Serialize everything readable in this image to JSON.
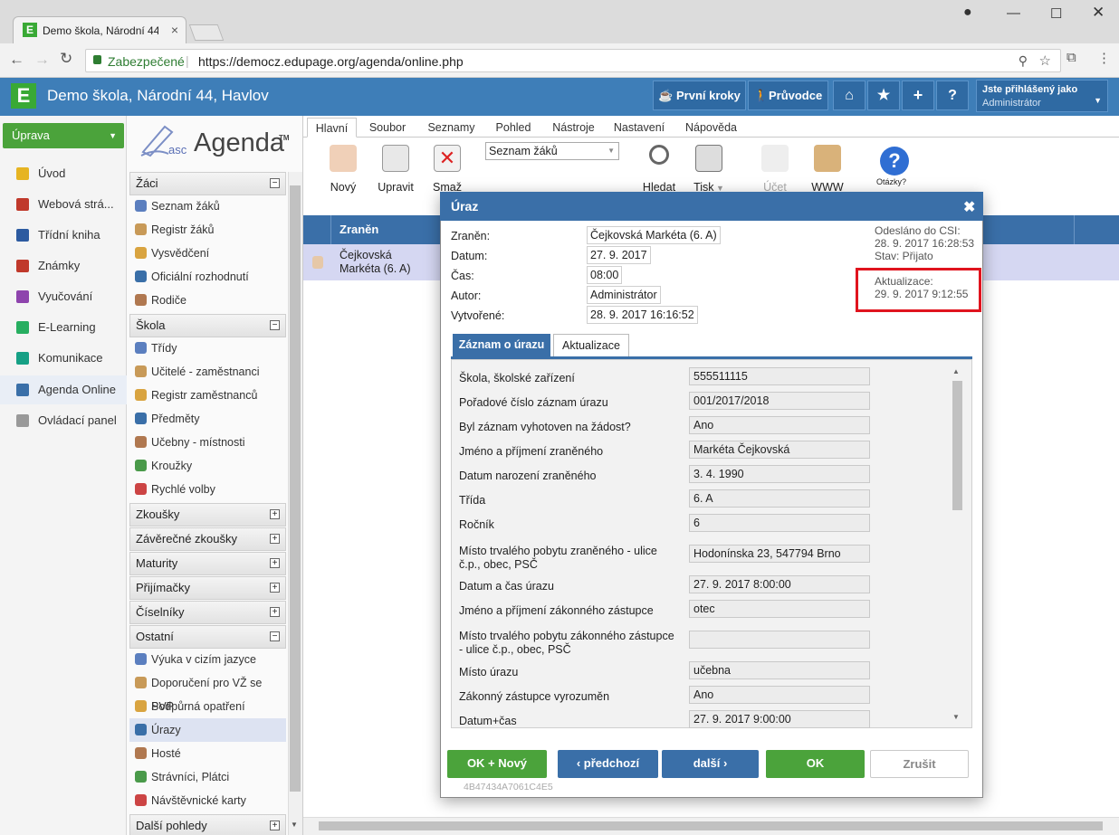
{
  "browser": {
    "tab_title": "Demo škola, Národní 44",
    "secure_label": "Zabezpečené",
    "url": "https://democz.edupage.org/agenda/online.php"
  },
  "header": {
    "school_name": "Demo škola, Národní 44, Havlov",
    "btn_first_steps": "První kroky",
    "btn_guide": "Průvodce",
    "logged_in_label": "Jste přihlášený jako",
    "logged_in_user": "Administrátor"
  },
  "leftnav": {
    "edit_button": "Úprava",
    "items": [
      {
        "label": "Úvod",
        "color": "#e6b422"
      },
      {
        "label": "Webová strá...",
        "color": "#c0392b"
      },
      {
        "label": "Třídní kniha",
        "color": "#2c5aa0"
      },
      {
        "label": "Známky",
        "color": "#c0392b"
      },
      {
        "label": "Vyučování",
        "color": "#8e44ad"
      },
      {
        "label": "E-Learning",
        "color": "#27ae60"
      },
      {
        "label": "Komunikace",
        "color": "#16a085"
      },
      {
        "label": "Agenda Online",
        "color": "#3a6fa8"
      },
      {
        "label": "Ovládací panel",
        "color": "#999999"
      }
    ]
  },
  "panel2": {
    "logo_asc": "asc",
    "logo_agenda": "Agenda",
    "logo_tm": "TM",
    "sections": {
      "zaci": "Žáci",
      "skola": "Škola",
      "zkousky": "Zkoušky",
      "zaverecne": "Závěrečné zkoušky",
      "maturity": "Maturity",
      "prijimacky": "Přijímačky",
      "ciselniky": "Číselníky",
      "ostatni": "Ostatní",
      "dalsi": "Další pohledy"
    },
    "zaci_items": [
      "Seznam žáků",
      "Registr žáků",
      "Vysvědčení",
      "Oficiální rozhodnutí",
      "Rodiče"
    ],
    "skola_items": [
      "Třídy",
      "Učitelé - zaměstnanci",
      "Registr zaměstnanců",
      "Předměty",
      "Učebny - místnosti",
      "Kroužky",
      "Rychlé volby"
    ],
    "ostatni_items": [
      "Výuka v cizím jazyce",
      "Doporučení pro VŽ se SVP",
      "Podpůrná opatření",
      "Úrazy",
      "Hosté",
      "Strávníci, Plátci",
      "Návštěvnické karty"
    ]
  },
  "ribbon": {
    "tabs": [
      "Hlavní",
      "Soubor",
      "Seznamy",
      "Pohled",
      "Nástroje",
      "Nastavení",
      "Nápověda"
    ],
    "btn_new": "Nový",
    "btn_edit": "Upravit",
    "btn_delete": "Smaž",
    "dropdown_value": "Seznam žáků",
    "btn_search": "Hledat",
    "btn_print": "Tisk",
    "btn_account": "Účet",
    "btn_www": "WWW",
    "btn_questions": "Otázky?"
  },
  "grid": {
    "col_injured": "Zraněn",
    "row_name": "Čejkovská Markéta (6. A)"
  },
  "dialog": {
    "title": "Úraz",
    "fields": {
      "injured_label": "Zraněn:",
      "injured_value": "Čejkovská Markéta (6. A)",
      "date_label": "Datum:",
      "date_value": "27. 9. 2017",
      "time_label": "Čas:",
      "time_value": "08:00",
      "author_label": "Autor:",
      "author_value": "Administrátor",
      "created_label": "Vytvořené:",
      "created_value": "28. 9. 2017 16:16:52"
    },
    "sent_label": "Odesláno do CSI:",
    "sent_value": "28. 9. 2017 16:28:53",
    "state_value": "Stav: Přijato",
    "update_label": "Aktualizace:",
    "update_value": "29. 9. 2017 9:12:55",
    "tab_record": "Záznam o úrazu",
    "tab_update": "Aktualizace",
    "form": [
      {
        "label": "Škola, školské zařízení",
        "value": "555511115"
      },
      {
        "label": "Pořadové číslo záznam úrazu",
        "value": "001/2017/2018"
      },
      {
        "label": "Byl záznam vyhotoven na žádost?",
        "value": "Ano"
      },
      {
        "label": "Jméno a příjmení zraněného",
        "value": "Markéta Čejkovská"
      },
      {
        "label": "Datum narození zraněného",
        "value": "3. 4. 1990"
      },
      {
        "label": "Třída",
        "value": "6. A"
      },
      {
        "label": "Ročník",
        "value": "6"
      },
      {
        "label": "Místo trvalého pobytu zraněného - ulice č.p., obec, PSČ",
        "value": "Hodonínska 23, 547794 Brno"
      },
      {
        "label": "Datum a čas úrazu",
        "value": "27. 9. 2017 8:00:00"
      },
      {
        "label": "Jméno a příjmení zákonného zástupce",
        "value": "otec"
      },
      {
        "label": "Místo trvalého pobytu zákonného zástupce - ulice č.p., obec, PSČ",
        "value": ""
      },
      {
        "label": "Místo úrazu",
        "value": "učebna"
      },
      {
        "label": "Zákonný zástupce vyrozuměn",
        "value": "Ano"
      },
      {
        "label": "Datum+čas",
        "value": "27. 9. 2017 9:00:00"
      }
    ],
    "btn_ok_new": "OK + Nový",
    "btn_prev": "předchozí",
    "btn_next": "další",
    "btn_ok": "OK",
    "btn_cancel": "Zrušit",
    "hash": "4B47434A7061C4E5"
  }
}
